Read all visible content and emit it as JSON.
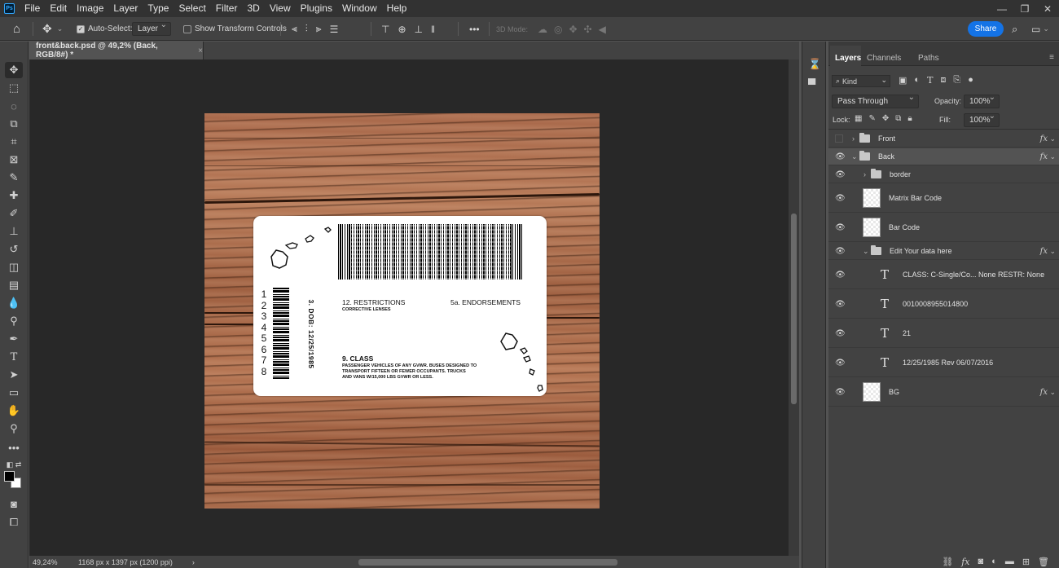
{
  "app": {
    "logo": "Ps"
  },
  "menu": [
    "File",
    "Edit",
    "Image",
    "Layer",
    "Type",
    "Select",
    "Filter",
    "3D",
    "View",
    "Plugins",
    "Window",
    "Help"
  ],
  "window_controls": [
    "—",
    "❐",
    "✕"
  ],
  "options": {
    "auto_select_label": "Auto-Select:",
    "auto_select_value": "Layer",
    "show_transform_label": "Show Transform Controls",
    "more": "•••",
    "mode_3d_label": "3D Mode:",
    "share_label": "Share"
  },
  "document": {
    "tab_title": "front&back.psd @ 49,2% (Back, RGB/8#) *",
    "tab_close": "×",
    "zoom": "49,24%",
    "dimensions": "1168 px x 1397 px (1200 ppi)",
    "nav_arrow": "›"
  },
  "card": {
    "dob_label": "3. DOB: 12/25/1985",
    "vertical_digits": [
      "1",
      "2",
      "3",
      "4",
      "5",
      "6",
      "7",
      "8"
    ],
    "restrictions_title": "12. RESTRICTIONS",
    "restrictions_value": "CORRECTIVE LENSES",
    "endorsements_title": "5a. ENDORSEMENTS",
    "class_title": "9. CLASS",
    "class_description_lines": [
      "PASSENGER VEHICLES OF ANY GVWR. BUSES DESIGNED TO",
      "TRANSPORT FIFTEEN OR FEWER OCCUPANTS. TRUCKS",
      "AND VANS W/15,000 LBS GVWR OR LESS."
    ]
  },
  "panel": {
    "tabs": [
      "Layers",
      "Channels",
      "Paths"
    ],
    "kind_label": "Kind",
    "blend_mode": "Pass Through",
    "opacity_label": "Opacity:",
    "opacity_value": "100%",
    "lock_label": "Lock:",
    "fill_label": "Fill:",
    "fill_value": "100%",
    "layers": [
      {
        "name": "Front",
        "type": "group",
        "visible": false,
        "expanded": false,
        "indent": 0,
        "fx": true
      },
      {
        "name": "Back",
        "type": "group",
        "visible": true,
        "expanded": true,
        "indent": 0,
        "fx": true,
        "selected": true
      },
      {
        "name": "border",
        "type": "group",
        "visible": true,
        "expanded": false,
        "indent": 1,
        "fx": false
      },
      {
        "name": "Matrix Bar Code",
        "type": "pixel",
        "visible": true,
        "indent": 1,
        "fx": false
      },
      {
        "name": "Bar Code",
        "type": "pixel",
        "visible": true,
        "indent": 1,
        "fx": false
      },
      {
        "name": "Edit Your data here",
        "type": "group",
        "visible": true,
        "expanded": true,
        "indent": 1,
        "fx": true
      },
      {
        "name": "CLASS: C-Single/Co... None RESTR: None",
        "type": "text",
        "visible": true,
        "indent": 2,
        "fx": false
      },
      {
        "name": "0010008955014800",
        "type": "text",
        "visible": true,
        "indent": 2,
        "fx": false
      },
      {
        "name": "21",
        "type": "text",
        "visible": true,
        "indent": 2,
        "fx": false
      },
      {
        "name": "12/25/1985 Rev 06/07/2016",
        "type": "text",
        "visible": true,
        "indent": 2,
        "fx": false
      },
      {
        "name": "BG",
        "type": "pixel",
        "visible": true,
        "indent": 0,
        "fx": true
      }
    ],
    "fx_glyph": "fx"
  },
  "colors": {
    "accent": "#1473e6",
    "ui_dark": "#323232",
    "ui_mid": "#424242",
    "canvas_bg": "#282828",
    "wood": "#a8684a"
  }
}
